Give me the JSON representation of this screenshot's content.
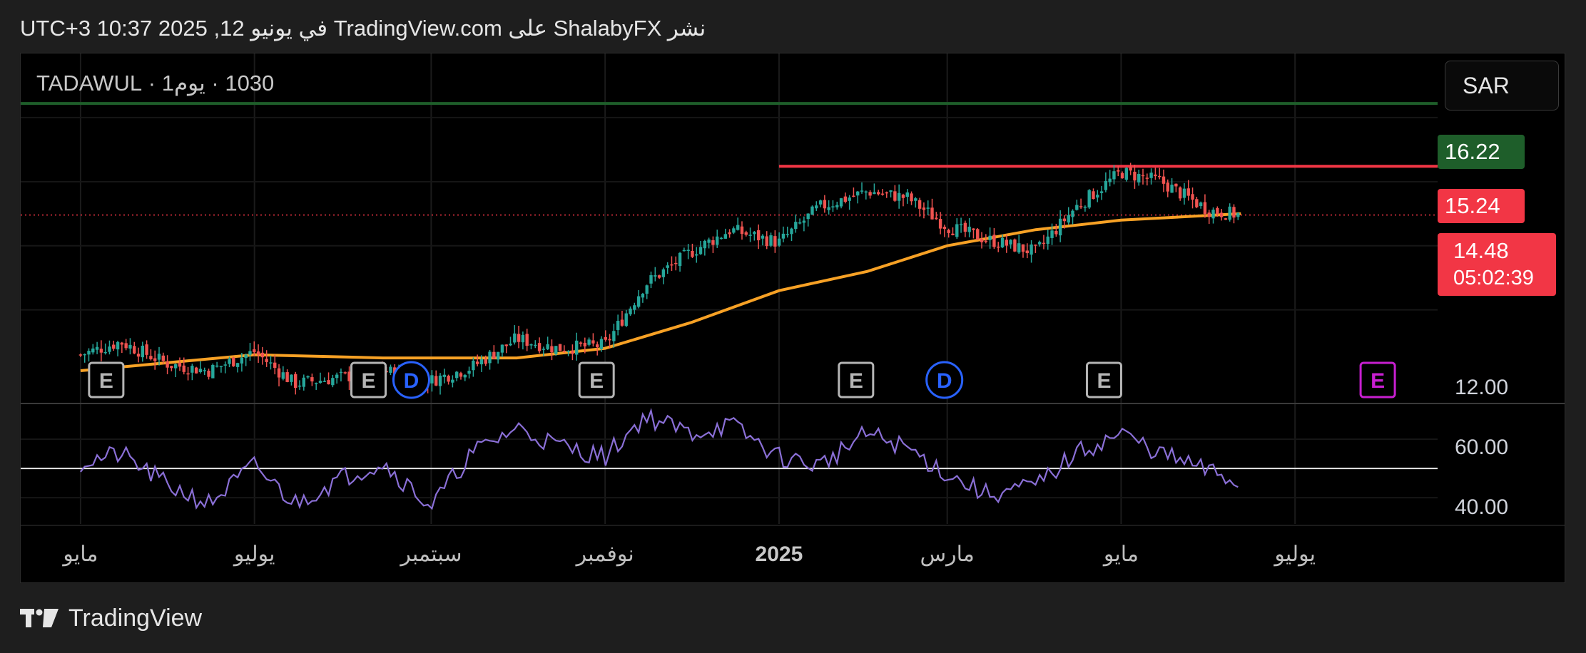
{
  "header": {
    "text": "نشر ShalabyFX على TradingView.com في يونيو 12, 2025 10:37 UTC+3"
  },
  "symbol_line": "1030 · يوم1 · TADAWUL",
  "currency_button": "SAR",
  "footer": {
    "brand": "TradingView",
    "logo_icon": "tradingview-logo-icon"
  },
  "colors": {
    "up": "#26a69a",
    "down": "#ef5350",
    "ma": "#f7a125",
    "rsi": "#8a6fd6",
    "green_line": "#1e5e2a",
    "red_line": "#f23645",
    "earn": "#b5b5b5",
    "div": "#2962ff",
    "earn_future": "#c81fd1"
  },
  "price_tags": {
    "green": "16.22",
    "red": "15.24",
    "last": "14.48",
    "countdown": "05:02:39",
    "axis_12": "12.00"
  },
  "chart_data": {
    "type": "candlestick",
    "title": "",
    "x_labels": [
      "مايو",
      "يوليو",
      "سبتمبر",
      "نوفمبر",
      "2025",
      "مارس",
      "مايو",
      "يوليو"
    ],
    "price_axis": {
      "ticks": [
        "12.00"
      ],
      "ylim": [
        11.55,
        17.0
      ]
    },
    "horizontal_lines": [
      {
        "name": "resistance-top",
        "value": 16.22,
        "color": "green"
      },
      {
        "name": "resistance",
        "value": 15.24,
        "color": "red",
        "from": "2025-01"
      }
    ],
    "last_price": 14.48,
    "price_path": [
      [
        "2024-05-01",
        12.3
      ],
      [
        "2024-05-15",
        12.5
      ],
      [
        "2024-06-01",
        12.15
      ],
      [
        "2024-06-15",
        12.05
      ],
      [
        "2024-07-01",
        12.35
      ],
      [
        "2024-07-15",
        11.85
      ],
      [
        "2024-08-01",
        11.95
      ],
      [
        "2024-08-15",
        12.05
      ],
      [
        "2024-09-01",
        11.9
      ],
      [
        "2024-09-15",
        12.1
      ],
      [
        "2024-10-01",
        12.55
      ],
      [
        "2024-10-15",
        12.4
      ],
      [
        "2024-11-01",
        12.45
      ],
      [
        "2024-11-15",
        13.4
      ],
      [
        "2024-12-01",
        13.9
      ],
      [
        "2024-12-15",
        14.25
      ],
      [
        "2025-01-01",
        14.05
      ],
      [
        "2025-01-15",
        14.6
      ],
      [
        "2025-02-01",
        14.85
      ],
      [
        "2025-02-15",
        14.75
      ],
      [
        "2025-03-01",
        14.3
      ],
      [
        "2025-03-15",
        14.1
      ],
      [
        "2025-04-01",
        13.9
      ],
      [
        "2025-04-15",
        14.6
      ],
      [
        "2025-05-01",
        15.15
      ],
      [
        "2025-05-15",
        15.0
      ],
      [
        "2025-06-01",
        14.55
      ],
      [
        "2025-06-12",
        14.48
      ]
    ],
    "moving_average_path": [
      [
        "2024-05-01",
        12.05
      ],
      [
        "2024-07-01",
        12.3
      ],
      [
        "2024-08-15",
        12.25
      ],
      [
        "2024-10-01",
        12.25
      ],
      [
        "2024-11-01",
        12.4
      ],
      [
        "2024-12-01",
        12.8
      ],
      [
        "2025-01-01",
        13.3
      ],
      [
        "2025-02-01",
        13.6
      ],
      [
        "2025-03-01",
        14.0
      ],
      [
        "2025-04-01",
        14.25
      ],
      [
        "2025-05-01",
        14.4
      ],
      [
        "2025-06-12",
        14.5
      ]
    ],
    "events": [
      {
        "type": "E",
        "date": "2024-05-10"
      },
      {
        "type": "E",
        "date": "2024-08-10"
      },
      {
        "type": "D",
        "date": "2024-08-25"
      },
      {
        "type": "E",
        "date": "2024-10-29"
      },
      {
        "type": "E",
        "date": "2025-01-28"
      },
      {
        "type": "D",
        "date": "2025-02-28"
      },
      {
        "type": "E",
        "date": "2025-04-25"
      },
      {
        "type": "E",
        "date": "2025-07-30",
        "future": true
      }
    ],
    "rsi": {
      "ticks": [
        "60.00",
        "40.00"
      ],
      "level": 50,
      "ylim": [
        31,
        72
      ],
      "path": [
        [
          "2024-05-01",
          52
        ],
        [
          "2024-05-15",
          55
        ],
        [
          "2024-06-01",
          44
        ],
        [
          "2024-06-15",
          38
        ],
        [
          "2024-07-01",
          51
        ],
        [
          "2024-07-15",
          38
        ],
        [
          "2024-08-01",
          47
        ],
        [
          "2024-08-15",
          52
        ],
        [
          "2024-09-01",
          37
        ],
        [
          "2024-09-15",
          55
        ],
        [
          "2024-10-01",
          64
        ],
        [
          "2024-10-15",
          58
        ],
        [
          "2024-11-01",
          54
        ],
        [
          "2024-11-15",
          68
        ],
        [
          "2024-12-01",
          62
        ],
        [
          "2024-12-15",
          65
        ],
        [
          "2025-01-01",
          54
        ],
        [
          "2025-01-15",
          51
        ],
        [
          "2025-02-01",
          62
        ],
        [
          "2025-02-15",
          57
        ],
        [
          "2025-03-01",
          48
        ],
        [
          "2025-03-15",
          41
        ],
        [
          "2025-04-01",
          44
        ],
        [
          "2025-04-15",
          55
        ],
        [
          "2025-05-01",
          62
        ],
        [
          "2025-05-15",
          55
        ],
        [
          "2025-06-01",
          49
        ],
        [
          "2025-06-12",
          45
        ]
      ]
    }
  }
}
